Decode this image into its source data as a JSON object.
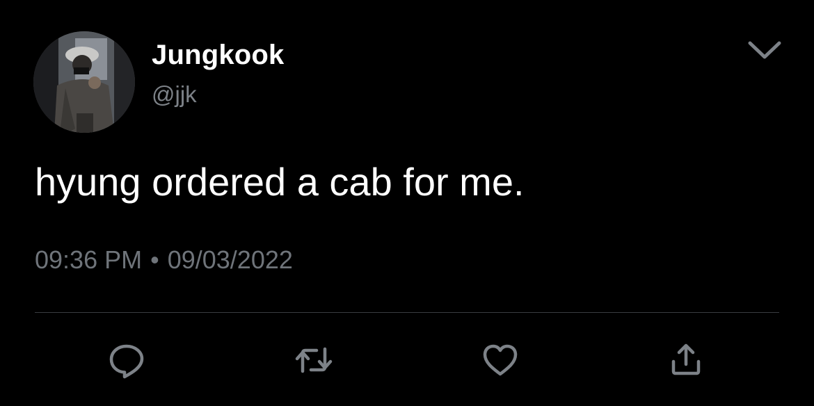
{
  "tweet": {
    "author": {
      "display_name": "Jungkook",
      "handle": "@jjk"
    },
    "text": "hyung ordered a cab for me.",
    "time": "09:36 PM",
    "separator": "•",
    "date": "09/03/2022"
  },
  "icons": {
    "menu": "chevron-down-icon",
    "reply": "reply-bubble-icon",
    "retweet": "retweet-icon",
    "like": "heart-icon",
    "share": "share-icon"
  },
  "colors": {
    "background": "#000000",
    "primary_text": "#ffffff",
    "secondary_text": "#7d8288",
    "icon": "#7d8288",
    "divider": "#3a3d41"
  }
}
